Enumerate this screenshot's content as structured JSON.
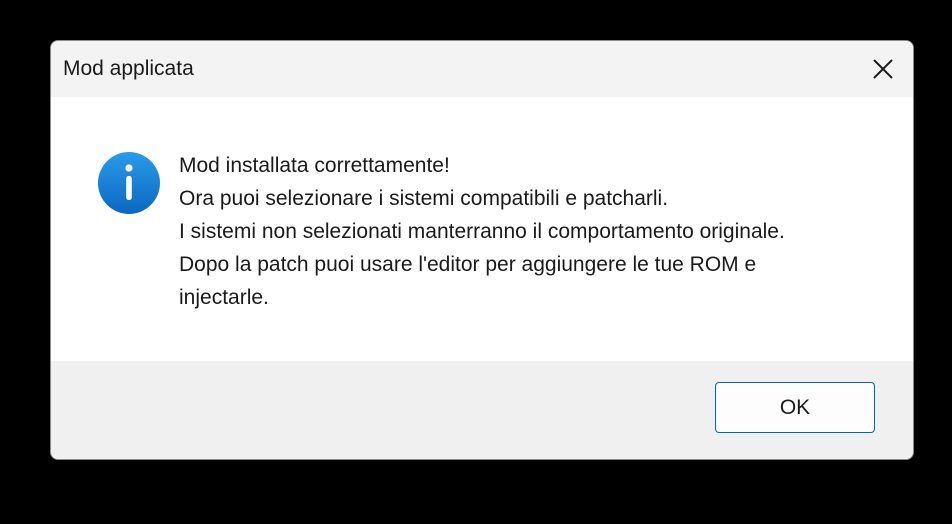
{
  "dialog": {
    "title": "Mod applicata",
    "close_icon": "close-icon",
    "info_icon": "info-icon",
    "message_lines": [
      "Mod installata correttamente!",
      "Ora puoi selezionare i sistemi compatibili e patcharli.",
      "I sistemi non selezionati manterranno il comportamento originale.",
      "Dopo la patch puoi usare l'editor per aggiungere le tue ROM e",
      "injectarle."
    ],
    "ok_label": "OK"
  },
  "colors": {
    "accent": "#0067c0",
    "info_icon_blue": "#1a86d9",
    "content_bg": "#ffffff",
    "footer_bg": "#f0f0f0"
  }
}
